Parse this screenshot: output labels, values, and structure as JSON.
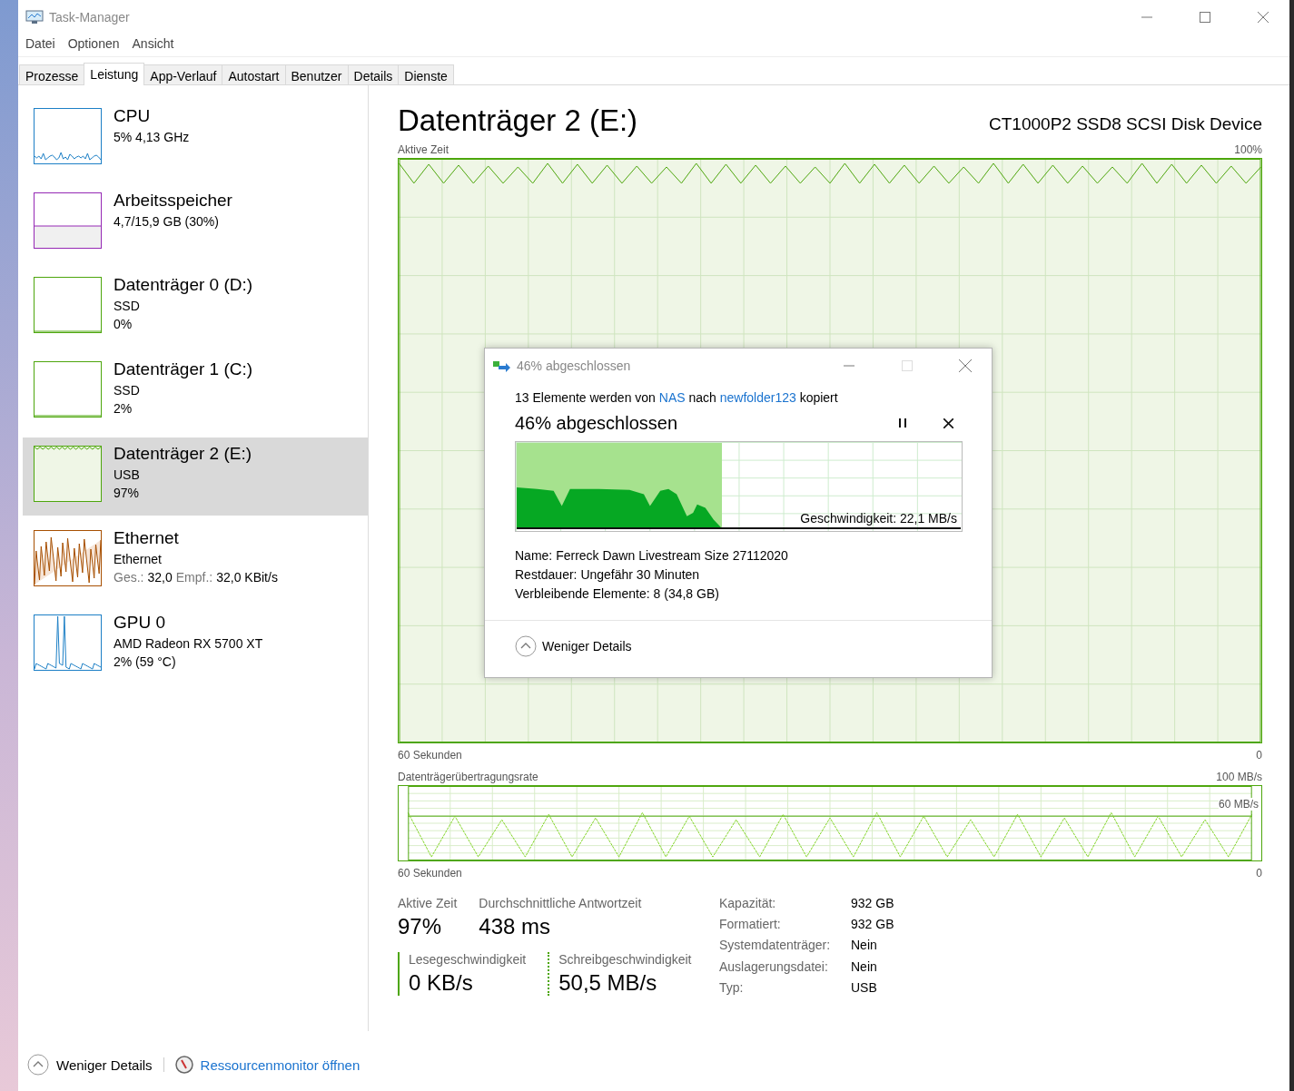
{
  "window": {
    "title": "Task-Manager"
  },
  "menu": [
    "Datei",
    "Optionen",
    "Ansicht"
  ],
  "tabs": [
    {
      "label": "Prozesse",
      "selected": false
    },
    {
      "label": "Leistung",
      "selected": true
    },
    {
      "label": "App-Verlauf",
      "selected": false
    },
    {
      "label": "Autostart",
      "selected": false
    },
    {
      "label": "Benutzer",
      "selected": false
    },
    {
      "label": "Details",
      "selected": false
    },
    {
      "label": "Dienste",
      "selected": false
    }
  ],
  "sidebar": {
    "items": [
      {
        "kind": "cpu",
        "color": "#1c7fc6",
        "selected": false,
        "title": "CPU",
        "lines": [
          [
            {
              "text": "5%  4,13 GHz",
              "kind": "value"
            }
          ]
        ]
      },
      {
        "kind": "memory",
        "color": "#9528b4",
        "selected": false,
        "title": "Arbeitsspeicher",
        "lines": [
          [
            {
              "text": "4,7/15,9 GB (30%)",
              "kind": "value"
            }
          ]
        ]
      },
      {
        "kind": "disk",
        "color": "#4da60c",
        "selected": false,
        "title": "Datenträger 0 (D:)",
        "lines": [
          [
            {
              "text": "SSD",
              "kind": "value"
            }
          ],
          [
            {
              "text": "0%",
              "kind": "value"
            }
          ]
        ]
      },
      {
        "kind": "disk",
        "color": "#4da60c",
        "selected": false,
        "title": "Datenträger 1 (C:)",
        "lines": [
          [
            {
              "text": "SSD",
              "kind": "value"
            }
          ],
          [
            {
              "text": "2%",
              "kind": "value"
            }
          ]
        ]
      },
      {
        "kind": "busy",
        "color": "#4da60c",
        "selected": true,
        "title": "Datenträger 2 (E:)",
        "lines": [
          [
            {
              "text": "USB",
              "kind": "value"
            }
          ],
          [
            {
              "text": "97%",
              "kind": "value"
            }
          ]
        ]
      },
      {
        "kind": "network",
        "color": "#a74f01",
        "selected": false,
        "title": "Ethernet",
        "lines": [
          [
            {
              "text": "Ethernet",
              "kind": "value"
            }
          ],
          [
            {
              "text": "Ges.:",
              "kind": "label"
            },
            {
              "text": "32,0",
              "kind": "value"
            },
            {
              "text": "Empf.:",
              "kind": "label"
            },
            {
              "text": "32,0 KBit/s",
              "kind": "value"
            }
          ]
        ]
      },
      {
        "kind": "gpu",
        "color": "#1c7fc6",
        "selected": false,
        "title": "GPU 0",
        "lines": [
          [
            {
              "text": "AMD Radeon RX 5700 XT",
              "kind": "value"
            }
          ],
          [
            {
              "text": "2%  (59 °C)",
              "kind": "value"
            }
          ]
        ]
      }
    ]
  },
  "main": {
    "title": "Datenträger 2 (E:)",
    "device": "CT1000P2 SSD8 SCSI Disk Device",
    "activity_graph": {
      "label": "Aktive Zeit",
      "max": "100%",
      "time": "60 Sekunden",
      "min": "0"
    },
    "transfer_graph": {
      "label": "Datenträgerübertragungsrate",
      "max": "100 MB/s",
      "scale": "60 MB/s",
      "time": "60 Sekunden",
      "min": "0"
    },
    "stats": [
      {
        "label": "Aktive Zeit",
        "value": "97%"
      },
      {
        "label": "Durchschnittliche Antwortzeit",
        "value": "438 ms"
      }
    ],
    "speeds": [
      {
        "kind": "read",
        "label": "Lesegeschwindigkeit",
        "value": "0 KB/s"
      },
      {
        "kind": "write",
        "label": "Schreibgeschwindigkeit",
        "value": "50,5 MB/s"
      }
    ],
    "properties": [
      {
        "label": "Kapazität:",
        "value": "932 GB"
      },
      {
        "label": "Formatiert:",
        "value": "932 GB"
      },
      {
        "label": "Systemdatenträger:",
        "value": "Nein"
      },
      {
        "label": "Auslagerungsdatei:",
        "value": "Nein"
      },
      {
        "label": "Typ:",
        "value": "USB"
      }
    ]
  },
  "footer": {
    "details": "Weniger Details",
    "link": "Ressourcenmonitor öffnen"
  },
  "dialog": {
    "title": "46% abgeschlossen",
    "message": [
      {
        "text": "13 Elemente werden von ",
        "kind": "text"
      },
      {
        "text": "NAS",
        "kind": "link"
      },
      {
        "text": " nach ",
        "kind": "text"
      },
      {
        "text": "newfolder123",
        "kind": "link"
      },
      {
        "text": " kopiert",
        "kind": "text"
      }
    ],
    "heading": "46% abgeschlossen",
    "level": 0.46,
    "speed": "Geschwindigkeit: 22,1 MB/s",
    "details": [
      {
        "label": "Name:",
        "value": "Ferreck Dawn Livestream Size 27112020"
      },
      {
        "label": "Restdauer:",
        "value": "Ungefähr 30 Minuten"
      },
      {
        "label": "Verbleibende Elemente:",
        "value": "8 (34,8 GB)"
      }
    ],
    "toggle": "Weniger Details"
  }
}
